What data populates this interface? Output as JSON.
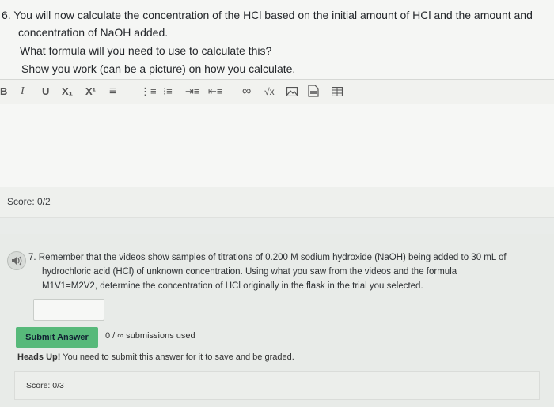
{
  "q6": {
    "line1": "6. You will now calculate the concentration of the HCl based on the initial amount of HCl and the amount and",
    "line2": "concentration of NaOH added.",
    "line3": "What formula will you need to use to calculate this?",
    "line4": "Show you work (can be a picture) on how you calculate."
  },
  "toolbar": {
    "bold": "B",
    "italic": "I",
    "underline": "U",
    "subscript": "X₁",
    "superscript": "X¹",
    "align": "≡",
    "numbered_list": "⋮≡",
    "bullet_list": "⁝≡",
    "indent": "⇥≡",
    "outdent": "⇤≡",
    "link": "∞",
    "formula": "√x",
    "icons": [
      "bold-icon",
      "italic-icon",
      "underline-icon",
      "subscript-icon",
      "superscript-icon",
      "align-icon",
      "numbered-list-icon",
      "bullet-list-icon",
      "indent-icon",
      "outdent-icon",
      "link-icon",
      "formula-icon",
      "image-icon",
      "pdf-icon",
      "table-icon"
    ]
  },
  "score1": "Score: 0/2",
  "q7": {
    "line1": "7. Remember that the videos show samples of titrations of 0.200 M sodium hydroxide (NaOH) being added to 30 mL of",
    "line2": "hydrochloric acid (HCl) of unknown concentration. Using what you saw from the videos and the formula",
    "line3": "M1V1=M2V2, determine the concentration of HCl originally in the flask in the trial you selected.",
    "speaker_icon": "speaker-icon",
    "answer_value": ""
  },
  "submit": {
    "label": "Submit Answer",
    "submissions": "0 / ∞ submissions used"
  },
  "heads_up": {
    "prefix": "Heads Up!",
    "text": " You need to submit this answer for it to save and be graded."
  },
  "score2": "Score: 0/3",
  "colors": {
    "submit_button": "#57b97a",
    "page_bg": "#e9ecea"
  }
}
